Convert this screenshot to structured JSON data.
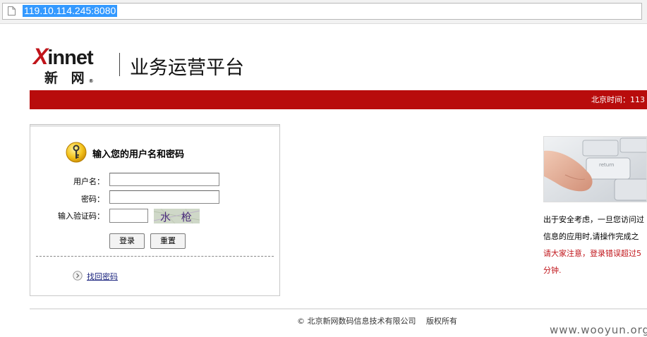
{
  "browser": {
    "url": "119.10.114.245:8080",
    "page_icon": "document-icon"
  },
  "header": {
    "logo_top_x": "X",
    "logo_top_rest": "innet",
    "logo_bottom": "新 网",
    "logo_reg": "®",
    "site_title": "业务运营平台"
  },
  "redbar": {
    "time_label": "北京时间：113"
  },
  "login": {
    "heading": "输入您的用户名和密码",
    "username_label": "用户名：",
    "password_label": "密码：",
    "captcha_label": "输入验证码：",
    "username_value": "",
    "password_value": "",
    "captcha_value": "",
    "captcha_image_text": "水 枪",
    "login_button": "登录",
    "reset_button": "重置",
    "find_password_link": "找回密码"
  },
  "notice": {
    "line1": "出于安全考虑，一旦您访问过",
    "line2": "信息的应用时,请操作完成之",
    "line3": "请大家注意，登录错误超过5",
    "line4": "分钟.",
    "warning_color": "#c0141a"
  },
  "footer": {
    "copyright": "© 北京新网数码信息技术有限公司　 版权所有",
    "watermark": "www.wooyun.org"
  },
  "colors": {
    "brand_red": "#b80c0c",
    "selection_blue": "#3399ff"
  }
}
